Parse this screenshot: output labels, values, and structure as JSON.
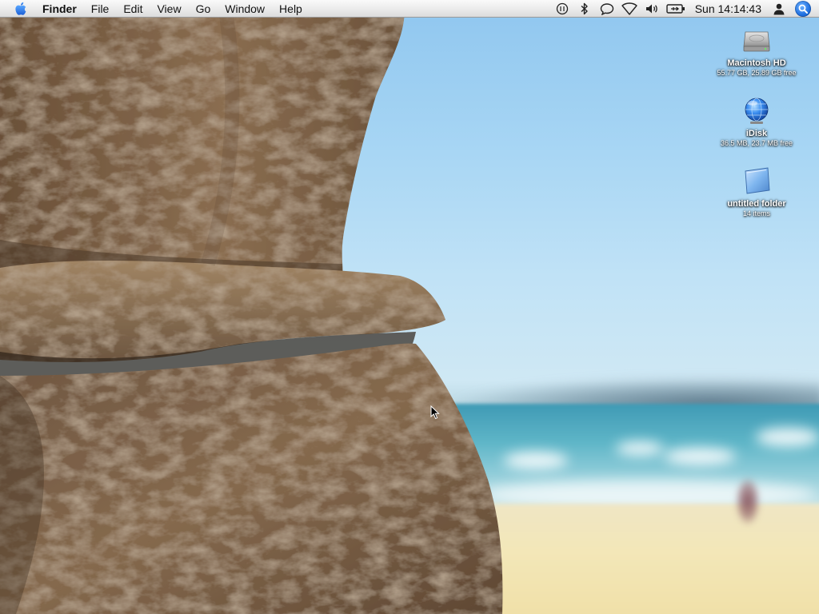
{
  "menubar": {
    "apple_icon": "apple-logo-icon",
    "app_name": "Finder",
    "menus": [
      "File",
      "Edit",
      "View",
      "Go",
      "Window",
      "Help"
    ],
    "status_icons": [
      "sync-icon",
      "bluetooth-icon",
      "ichat-icon",
      "wifi-icon",
      "volume-icon",
      "battery-icon"
    ],
    "clock": "Sun 14:14:43",
    "user_icon": "user-icon",
    "spotlight_icon": "spotlight-search-icon"
  },
  "desktop": {
    "icons": [
      {
        "name": "Macintosh HD",
        "info": "55.77 GB, 25.89 GB free",
        "icon": "hard-drive-icon"
      },
      {
        "name": "iDisk",
        "info": "36.5 MB, 23.7 MB free",
        "icon": "idisk-globe-icon"
      },
      {
        "name": "untitled folder",
        "info": "14 items",
        "icon": "folder-icon"
      }
    ]
  },
  "colors": {
    "menubar_top": "#fafafa",
    "menubar_bottom": "#dcdcdc",
    "accent_blue": "#1f6fe0",
    "sky": "#a8d6f4",
    "sea": "#3f9ab5",
    "rock": "#7a6148",
    "sand": "#f3e7b8"
  }
}
